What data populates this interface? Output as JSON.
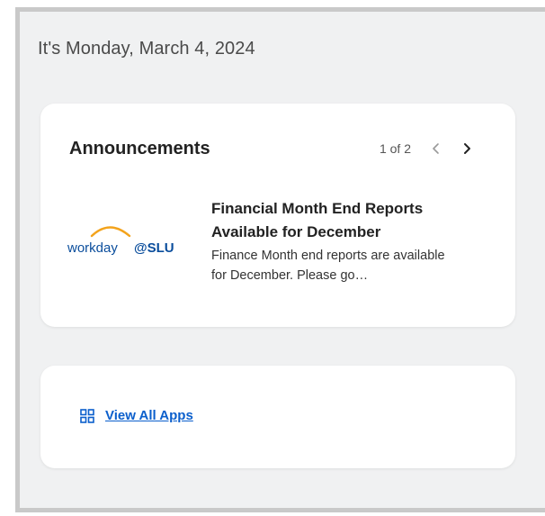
{
  "header": {
    "date_text": "It's Monday, March 4, 2024"
  },
  "announcements": {
    "title": "Announcements",
    "pager": {
      "current": 1,
      "total": 2,
      "text": "1 of 2"
    },
    "logo": {
      "word": "workday",
      "suffix": "@SLU",
      "icon": "workday-logo-icon"
    },
    "item": {
      "title": "Financial Month End Reports Available for December",
      "description": "Finance Month end reports are available for December. Please go…"
    }
  },
  "apps": {
    "link_label": "View All Apps",
    "icon": "grid-icon"
  },
  "colors": {
    "background": "#f0f1f2",
    "card": "#ffffff",
    "link": "#0b5fcc",
    "logo_orange": "#f3a31c",
    "logo_blue": "#0a4d9c",
    "pager_active": "#222222",
    "pager_disabled": "#9a9a9a"
  }
}
